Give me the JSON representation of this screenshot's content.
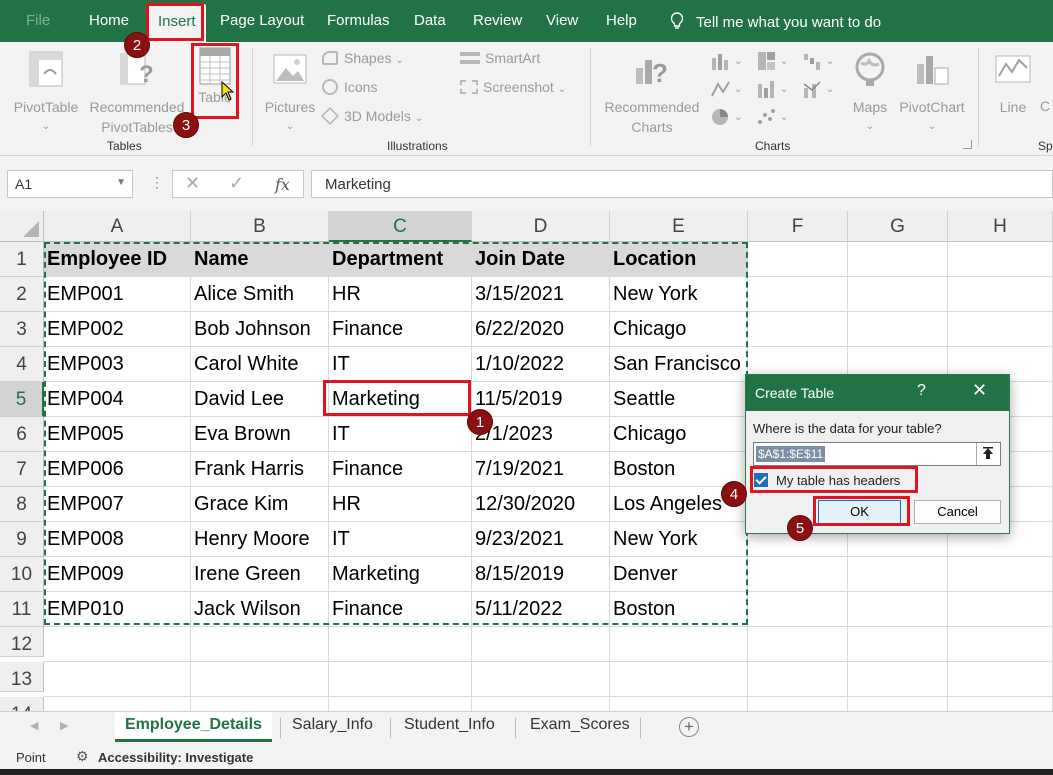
{
  "menu": {
    "tabs": [
      "File",
      "Home",
      "Insert",
      "Page Layout",
      "Formulas",
      "Data",
      "Review",
      "View",
      "Help"
    ],
    "active_tab": "Insert",
    "tell_me": "Tell me what you want to do"
  },
  "ribbon": {
    "tables": {
      "group_label": "Tables",
      "pivottable": "PivotTable",
      "recommended_pivottables_1": "Recommended",
      "recommended_pivottables_2": "PivotTables",
      "table": "Table"
    },
    "illustrations": {
      "group_label": "Illustrations",
      "pictures": "Pictures",
      "shapes": "Shapes",
      "icons": "Icons",
      "models_3d": "3D Models",
      "smartart": "SmartArt",
      "screenshot": "Screenshot"
    },
    "charts": {
      "group_label": "Charts",
      "recommended_charts_1": "Recommended",
      "recommended_charts_2": "Charts",
      "maps": "Maps",
      "pivotchart": "PivotChart"
    },
    "sparklines": {
      "group_label": "Sp",
      "line": "Line",
      "column": "C"
    }
  },
  "formula_bar": {
    "name_box": "A1",
    "formula": "Marketing"
  },
  "grid": {
    "columns": [
      "A",
      "B",
      "C",
      "D",
      "E",
      "F",
      "G",
      "H"
    ],
    "rows": [
      "1",
      "2",
      "3",
      "4",
      "5",
      "6",
      "7",
      "8",
      "9",
      "10",
      "11",
      "12",
      "13",
      "14"
    ],
    "headers": [
      "Employee ID",
      "Name",
      "Department",
      "Join Date",
      "Location"
    ],
    "data": [
      [
        "EMP001",
        "Alice Smith",
        "HR",
        "3/15/2021",
        "New York"
      ],
      [
        "EMP002",
        "Bob Johnson",
        "Finance",
        "6/22/2020",
        "Chicago"
      ],
      [
        "EMP003",
        "Carol White",
        "IT",
        "1/10/2022",
        "San Francisco"
      ],
      [
        "EMP004",
        "David Lee",
        "Marketing",
        "11/5/2019",
        "Seattle"
      ],
      [
        "EMP005",
        "Eva Brown",
        "IT",
        "2/1/2023",
        "Chicago"
      ],
      [
        "EMP006",
        "Frank Harris",
        "Finance",
        "7/19/2021",
        "Boston"
      ],
      [
        "EMP007",
        "Grace Kim",
        "HR",
        "12/30/2020",
        "Los Angeles"
      ],
      [
        "EMP008",
        "Henry Moore",
        "IT",
        "9/23/2021",
        "New York"
      ],
      [
        "EMP009",
        "Irene Green",
        "Marketing",
        "8/15/2019",
        "Denver"
      ],
      [
        "EMP010",
        "Jack Wilson",
        "Finance",
        "5/11/2022",
        "Boston"
      ]
    ]
  },
  "sheets": {
    "tabs": [
      "Employee_Details",
      "Salary_Info",
      "Student_Info",
      "Exam_Scores"
    ],
    "active": "Employee_Details"
  },
  "status": {
    "mode": "Point",
    "accessibility": "Accessibility: Investigate"
  },
  "dialog": {
    "title": "Create Table",
    "help": "?",
    "close": "✕",
    "prompt": "Where is the data for your table?",
    "range": "$A$1:$E$11",
    "headers_checkbox": "My table has headers",
    "headers_checked": true,
    "ok": "OK",
    "cancel": "Cancel"
  },
  "annotations": [
    "1",
    "2",
    "3",
    "4",
    "5"
  ],
  "colors": {
    "excel_green": "#217346",
    "highlight_red": "#e0141e",
    "badge": "#8b1111"
  }
}
